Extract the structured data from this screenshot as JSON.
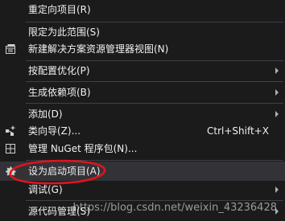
{
  "menu": {
    "items": [
      {
        "label": "重定向项目(R)"
      },
      {
        "label": "限定为此范围(S)"
      },
      {
        "label": "新建解决方案资源管理器视图(N)",
        "icon": "new-explorer-view-icon"
      },
      {
        "label": "按配置优化(P)",
        "has_submenu": true
      },
      {
        "label": "生成依赖项(B)",
        "has_submenu": true
      },
      {
        "label": "添加(D)",
        "has_submenu": true
      },
      {
        "label": "类向导(Z)...",
        "shortcut": "Ctrl+Shift+X",
        "icon": "class-wizard-icon"
      },
      {
        "label": "管理 NuGet 程序包(N)...",
        "icon": "nuget-package-icon"
      },
      {
        "label": "设为启动项目(A)",
        "icon": "gear-icon",
        "highlighted": true
      },
      {
        "label": "调试(G)",
        "has_submenu": true
      },
      {
        "label": "源代码管理(S)",
        "has_submenu": true
      }
    ]
  },
  "watermark": "https://blog.csdn.net/weixin_43236428",
  "colors": {
    "background": "#1b1b1c",
    "text": "#f1f1f1",
    "highlight": "#333337",
    "separator": "#3f3f46",
    "annotation": "#e0141e"
  }
}
